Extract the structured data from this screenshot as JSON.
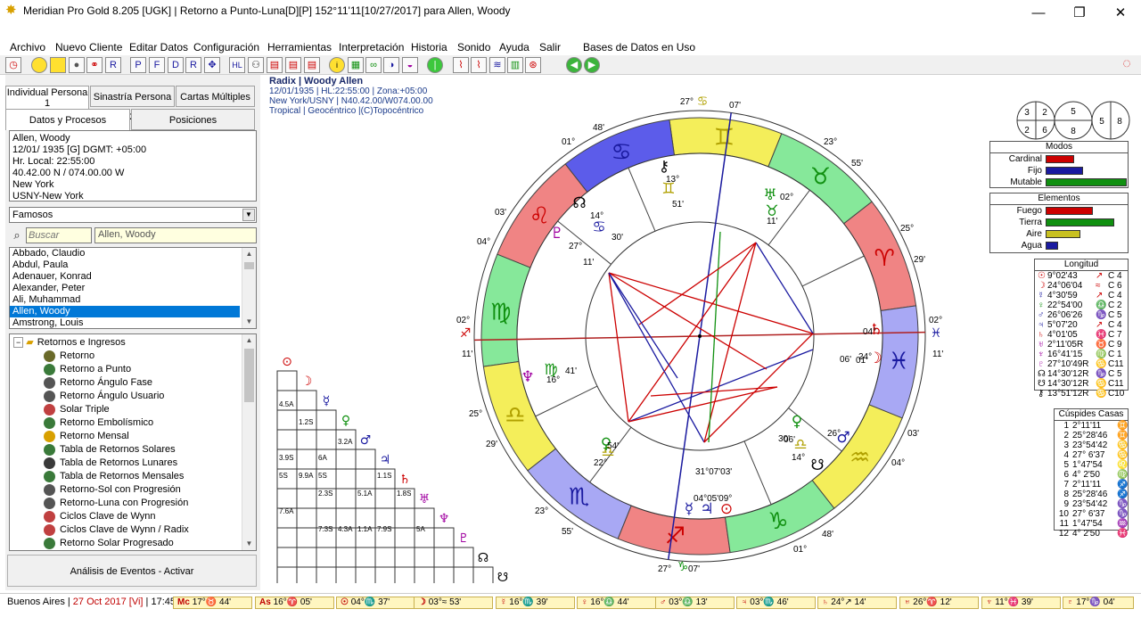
{
  "window": {
    "title": "Meridian Pro Gold 8.205 [UGK] | Retorno a Punto-Luna[D][P] 152°11'11[10/27/2017] para Allen, Woody",
    "minimize": "—",
    "maximize": "❐",
    "close": "✕"
  },
  "menu": [
    "Archivo",
    "Nuevo Cliente",
    "Editar Datos",
    "Configuración",
    "Herramientas",
    "Interpretación",
    "Historia",
    "Sonido",
    "Ayuda",
    "Salir",
    "Bases de Datos en Uso"
  ],
  "left": {
    "tabs_top": [
      "Individual Persona 1",
      "Sinastría Persona 2",
      "Cartas Múltiples"
    ],
    "tabs_sub": [
      "Datos y Procesos",
      "Posiciones"
    ],
    "info": [
      "Allen, Woody",
      "12/01/ 1935 [G]  DGMT: +05:00",
      "Hr. Local: 22:55:00",
      "40.42.00 N / 074.00.00 W",
      "New York",
      "USNY-New York"
    ],
    "combo_value": "Famosos",
    "search_placeholder": "Buscar",
    "search_value": "Allen, Woody",
    "names": [
      "Abbado, Claudio",
      "Abdul, Paula",
      "Adenauer, Konrad",
      "Alexander, Peter",
      "Ali, Muhammad",
      "Allen, Woody",
      "Amstrong, Louis"
    ],
    "selected_index": 5,
    "tree_root": "Retornos e Ingresos",
    "tree_items": [
      "Retorno",
      "Retorno a Punto",
      "Retorno Ángulo Fase",
      "Retorno Ángulo Usuario",
      "Solar Triple",
      "Retorno Embolísmico",
      "Retorno Mensal",
      "Tabla de Retornos Solares",
      "Tabla de Retornos Lunares",
      "Tabla de Retornos Mensales",
      "Retorno-Sol con Progresión",
      "Retorno-Luna con Progresión",
      "Ciclos Clave de Wynn",
      "Ciclos Clave de Wynn / Radix",
      "Retorno Solar Progresado"
    ],
    "events_button": "Análisis de Eventos - Activar"
  },
  "chart": {
    "title": "Radix | Woody Allen",
    "line2": "12/01/1935 | HL:22:55:00 | Zona:+05:00",
    "line3": "New York/USNY | N40.42.00/W074.00.00",
    "line4": "Tropical | Geocéntrico |(C)Topocéntrico",
    "cusp_labels": {
      "top": "27°",
      "top_min": "07'",
      "bottom": "27°",
      "bottom_min": "07'",
      "left_deg": "02°",
      "left_min": "11'",
      "right_deg": "02°",
      "right_min": "11'",
      "ul1": "01°",
      "ul1m": "48'",
      "ul2": "03'",
      "ul2m": "04°",
      "ur1": "23°",
      "ur1m": "55'",
      "ur2": "25°",
      "ur2m": "29'",
      "ll1": "25°",
      "ll1m": "29'",
      "ll2": "23°",
      "ll2m": "55'",
      "lr1": "03'",
      "lr1m": "04°",
      "lr2": "48'",
      "lr2m": "01°"
    },
    "planet_labels": [
      {
        "t": "13°",
        "c": "#000"
      },
      {
        "t": "51'",
        "c": "#000"
      },
      {
        "t": "14°",
        "c": "#000"
      },
      {
        "t": "30'",
        "c": "#000"
      },
      {
        "t": "27°",
        "c": "#000"
      },
      {
        "t": "11'",
        "c": "#000"
      },
      {
        "t": "02°",
        "c": "#000"
      },
      {
        "t": "11'",
        "c": "#000"
      },
      {
        "t": "16°",
        "c": "#000"
      },
      {
        "t": "41'",
        "c": "#000"
      },
      {
        "t": "04°",
        "c": "#000"
      },
      {
        "t": "01'",
        "c": "#000"
      },
      {
        "t": "24°",
        "c": "#000"
      },
      {
        "t": "06'",
        "c": "#000"
      },
      {
        "t": "26°",
        "c": "#000"
      },
      {
        "t": "06'",
        "c": "#000"
      },
      {
        "t": "14°",
        "c": "#000"
      },
      {
        "t": "30'",
        "c": "#000"
      },
      {
        "t": "22°",
        "c": "#000"
      },
      {
        "t": "54'",
        "c": "#000"
      },
      {
        "t": "31°07'03'",
        "c": "#000"
      },
      {
        "t": "04°05'09°",
        "c": "#000"
      }
    ]
  },
  "houses_legend": {
    "circle1": [
      "3",
      "2",
      "2",
      "6"
    ],
    "circle2": [
      "5",
      "8"
    ],
    "circle3": [
      "5",
      "8"
    ]
  },
  "modos": {
    "title": "Modos",
    "rows": [
      {
        "label": "Cardinal",
        "value": 0.45,
        "color": "#cc0000"
      },
      {
        "label": "Fijo",
        "value": 0.6,
        "color": "#1a1aa0"
      },
      {
        "label": "Mutable",
        "value": 1.3,
        "color": "#109010"
      }
    ]
  },
  "elementos": {
    "title": "Elementos",
    "rows": [
      {
        "label": "Fuego",
        "value": 0.75,
        "color": "#cc0000"
      },
      {
        "label": "Tierra",
        "value": 1.1,
        "color": "#109010"
      },
      {
        "label": "Aire",
        "value": 0.55,
        "color": "#c8c020"
      },
      {
        "label": "Agua",
        "value": 0.2,
        "color": "#1a1aa0"
      }
    ]
  },
  "longitud": {
    "title": "Longitud",
    "rows": [
      {
        "g": "☉",
        "v": "9°02'43",
        "s": "↗",
        "c": "C  4",
        "col": "#cc0000"
      },
      {
        "g": "☽",
        "v": "24°06'04",
        "s": "≈",
        "c": "C  6",
        "col": "#cc0000"
      },
      {
        "g": "☿",
        "v": "4°30'59",
        "s": "↗",
        "c": "C  4",
        "col": "#1a1aa0"
      },
      {
        "g": "♀",
        "v": "22°54'00",
        "s": "♎",
        "c": "C  2",
        "col": "#109010"
      },
      {
        "g": "♂",
        "v": "26°06'26",
        "s": "♑",
        "c": "C  5",
        "col": "#1a1aa0"
      },
      {
        "g": "♃",
        "v": "5°07'20",
        "s": "↗",
        "c": "C  4",
        "col": "#1a1aa0"
      },
      {
        "g": "♄",
        "v": "4°01'05",
        "s": "♓",
        "c": "C  7",
        "col": "#cc0000"
      },
      {
        "g": "♅",
        "v": "2°11'05R",
        "s": "♉",
        "c": "C  9",
        "col": "#a000a0"
      },
      {
        "g": "♆",
        "v": "16°41'15",
        "s": "♍",
        "c": "C  1",
        "col": "#a000a0"
      },
      {
        "g": "♇",
        "v": "27°10'49R",
        "s": "♋",
        "c": "C11",
        "col": "#a000a0"
      },
      {
        "g": "☊",
        "v": "14°30'12R",
        "s": "♑",
        "c": "C  5",
        "col": "#000"
      },
      {
        "g": "☋",
        "v": "14°30'12R",
        "s": "♋",
        "c": "C11",
        "col": "#000"
      },
      {
        "g": "⚷",
        "v": "13°51'12R",
        "s": "♋",
        "c": "C10",
        "col": "#000"
      }
    ]
  },
  "cuspides": {
    "title": "Cúspides Casas",
    "rows": [
      {
        "n": "1",
        "v": "2°11'11",
        "s": "♊"
      },
      {
        "n": "2",
        "v": "25°28'46",
        "s": "♊"
      },
      {
        "n": "3",
        "v": "23°54'42",
        "s": "♋"
      },
      {
        "n": "4",
        "v": "27° 6'37",
        "s": "♋"
      },
      {
        "n": "5",
        "v": "1°47'54",
        "s": "♌"
      },
      {
        "n": "6",
        "v": "4° 2'50",
        "s": "♍"
      },
      {
        "n": "7",
        "v": "2°11'11",
        "s": "♐"
      },
      {
        "n": "8",
        "v": "25°28'46",
        "s": "♐"
      },
      {
        "n": "9",
        "v": "23°54'42",
        "s": "♑"
      },
      {
        "n": "10",
        "v": "27° 6'37",
        "s": "♑"
      },
      {
        "n": "11",
        "v": "1°47'54",
        "s": "♒"
      },
      {
        "n": "12",
        "v": "4° 2'50",
        "s": "♓"
      }
    ]
  },
  "aspect_labels": [
    "4.5A",
    "1.2S",
    "3.2A",
    "3.9S",
    "6A",
    "5S",
    "9.9A",
    "5S",
    "1.1S",
    "2.3S",
    "5.1A",
    "1.8S",
    "7.6A",
    "7.3S",
    "4.3A",
    "1.1A",
    "7.9S",
    "5A"
  ],
  "status": {
    "location": "Buenos Aires | ",
    "date": "27 Oct 2017 [Vi]",
    "time": " | 17:45",
    "positions": [
      {
        "g": "Mc",
        "v": "17°♉ 44'"
      },
      {
        "g": "As",
        "v": "16°♈ 05'"
      },
      {
        "g": "☉",
        "v": "04°♏ 37'"
      },
      {
        "g": "☽",
        "v": "03°≈ 53'"
      },
      {
        "g": "☿",
        "v": "16°♏ 39'"
      },
      {
        "g": "♀",
        "v": "16°♎ 44'"
      },
      {
        "g": "♂",
        "v": "03°♎ 13'"
      },
      {
        "g": "♃",
        "v": "03°♏ 46'"
      },
      {
        "g": "♄",
        "v": "24°↗ 14'"
      },
      {
        "g": "♅",
        "v": "26°♈ 12'"
      },
      {
        "g": "♆",
        "v": "11°♓ 39'"
      },
      {
        "g": "♇",
        "v": "17°♑ 04'"
      }
    ]
  }
}
